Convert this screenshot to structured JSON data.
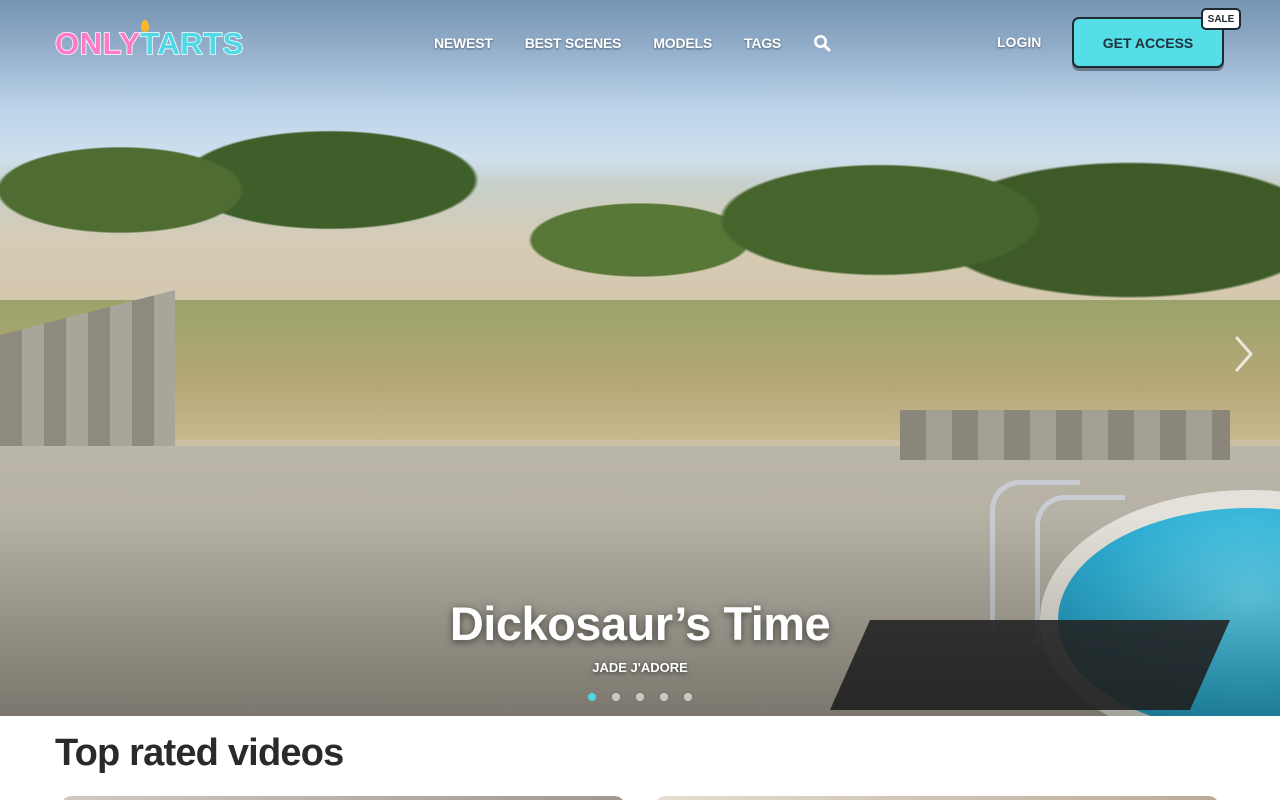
{
  "header": {
    "logo": {
      "part1": "ONLY",
      "part2": "TARTS"
    },
    "nav": [
      {
        "label": "NEWEST"
      },
      {
        "label": "BEST SCENES"
      },
      {
        "label": "MODELS"
      },
      {
        "label": "TAGS"
      }
    ],
    "search_icon": "search-icon",
    "login_label": "LOGIN",
    "cta_label": "GET ACCESS",
    "sale_badge": "SALE",
    "colors": {
      "brand_pink": "#ff7bc7",
      "brand_cyan": "#4fd8e6",
      "cta": "#55dde8"
    }
  },
  "hero": {
    "title": "Dickosaur’s Time",
    "model": "JADE J'ADORE",
    "slides": 5,
    "active_slide": 1,
    "next_icon": "chevron-right-icon"
  },
  "section": {
    "title": "Top rated videos"
  }
}
